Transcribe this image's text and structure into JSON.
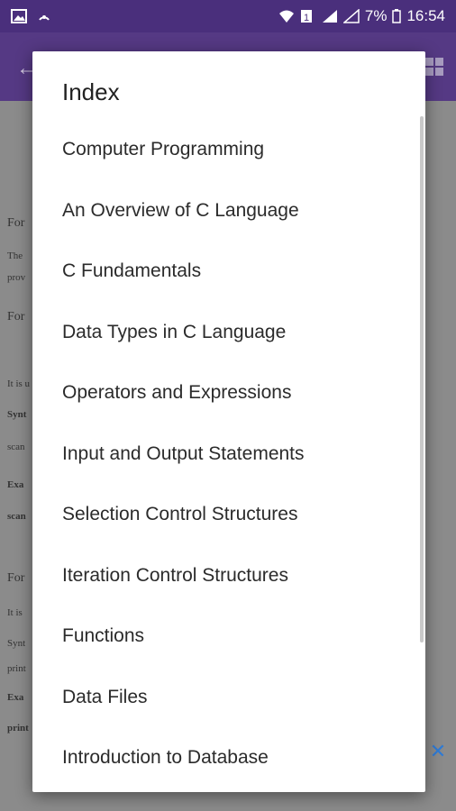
{
  "status_bar": {
    "battery": "7%",
    "time": "16:54",
    "icons": [
      "image-icon",
      "wifi-hotspot-icon",
      "wifi-icon",
      "sim-icon",
      "signal-icon",
      "signal-icon",
      "battery-icon"
    ]
  },
  "dialog": {
    "title": "Index",
    "items": [
      "Computer Programming",
      "An Overview of C Language",
      "C Fundamentals",
      "Data Types in C Language",
      "Operators and Expressions",
      "Input and Output Statements",
      "Selection Control Structures",
      "Iteration Control Structures",
      "Functions",
      "Data Files",
      "Introduction to Database"
    ]
  },
  "background_doc": {
    "fragments": [
      "For",
      "The",
      "prov",
      "For",
      "It is u",
      "Synt",
      "scan",
      "Exa",
      "scan",
      "For",
      "It is",
      "Synt",
      "print",
      "Exa",
      "print"
    ]
  },
  "colors": {
    "status_bar": "#4a2f7c",
    "app_bar": "#553984",
    "ad_close": "#2f7bd6"
  }
}
